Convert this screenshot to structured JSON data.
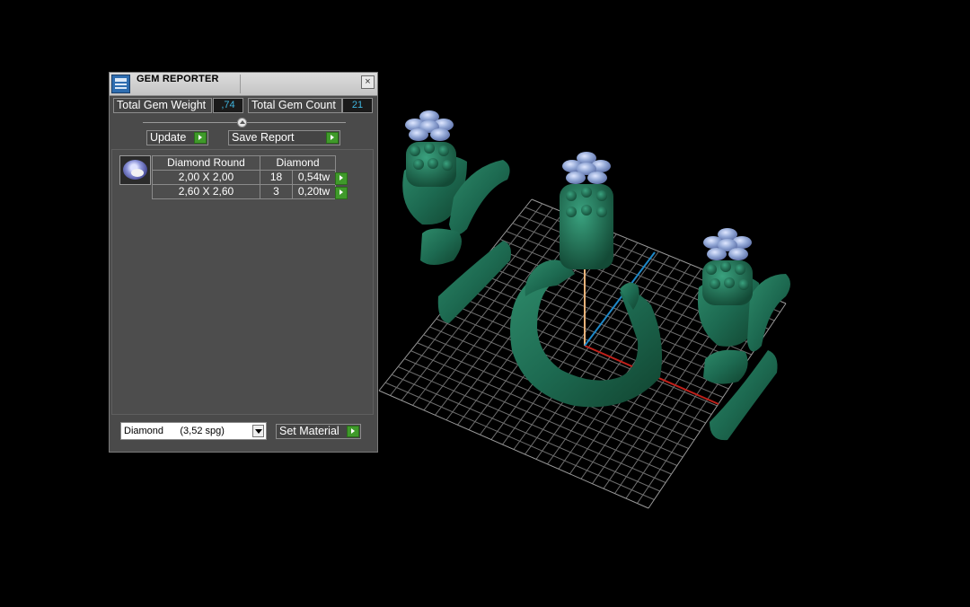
{
  "panel": {
    "title": "GEM REPORTER",
    "close_label": "×",
    "total_weight_label": "Total Gem Weight",
    "total_weight_value": ",74",
    "total_count_label": "Total Gem Count",
    "total_count_value": "21",
    "update_label": "Update",
    "save_report_label": "Save Report",
    "table": {
      "headers": [
        "Diamond Round",
        "Diamond"
      ],
      "rows": [
        {
          "size": "2,00 X 2,00",
          "count": "18",
          "weight": "0,54tw"
        },
        {
          "size": "2,60 X 2,60",
          "count": "3",
          "weight": "0,20tw"
        }
      ]
    },
    "material_select_value": "Diamond      (3,52 spg)",
    "set_material_label": "Set Material"
  },
  "icons": [
    "gem-reporter-icon",
    "close-icon",
    "slider-knob-icon",
    "go-arrow-icon",
    "gem-thumbnail-icon",
    "dropdown-arrow-icon"
  ],
  "colors": {
    "ring_green": "#1f6b52",
    "gem_blue": "#8aa2d2",
    "grid": "#6e6e6e",
    "axis_x": "#c0201a",
    "axis_y": "#e8b27a",
    "axis_z": "#1e88c8",
    "go_button": "#3f9a2a"
  }
}
